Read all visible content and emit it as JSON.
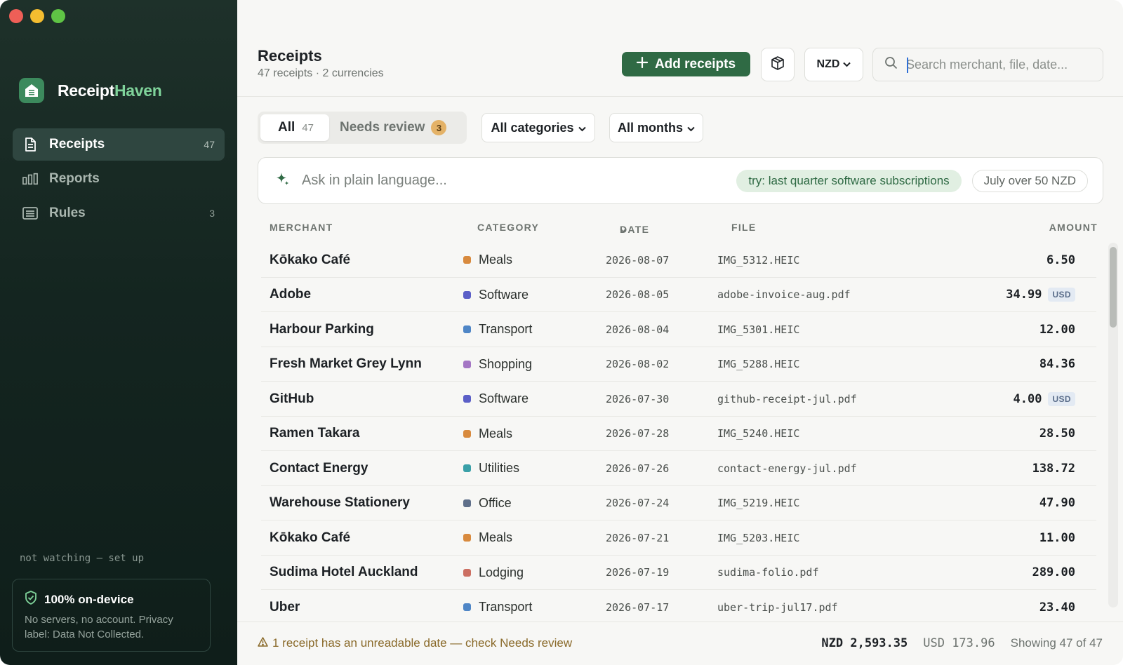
{
  "app": {
    "name_prefix": "Receipt",
    "name_accent": "Haven"
  },
  "colors": {
    "accent": "#2f6a44",
    "sidebar_bg": "#142520",
    "warning": "#8a6a2a"
  },
  "sidebar": {
    "items": [
      {
        "label": "Receipts",
        "count": "47",
        "icon": "receipt-icon",
        "active": true
      },
      {
        "label": "Reports",
        "count": "",
        "icon": "bar-chart-icon",
        "active": false
      },
      {
        "label": "Rules",
        "count": "3",
        "icon": "list-icon",
        "active": false
      }
    ],
    "watch_status": "not watching — set up",
    "privacy": {
      "title": "100% on-device",
      "text": "No servers, no account. Privacy label: Data Not Collected."
    }
  },
  "header": {
    "title": "Receipts",
    "receipt_count": "47 receipts",
    "separator": "·",
    "currency_count": "2 currencies",
    "add_label": "Add receipts",
    "currency": "NZD",
    "search_placeholder": "Search merchant, file, date..."
  },
  "filters": {
    "tabs": [
      {
        "label": "All",
        "count": "47"
      },
      {
        "label": "Needs review",
        "count": "3"
      }
    ],
    "category": "All categories",
    "month": "All months"
  },
  "ask": {
    "placeholder": "Ask in plain language...",
    "suggestion_1": "try: last quarter software subscriptions",
    "suggestion_2": "July over 50 NZD"
  },
  "table": {
    "columns": {
      "merchant": "MERCHANT",
      "category": "CATEGORY",
      "date": "DATE",
      "file": "FILE",
      "amount": "AMOUNT"
    },
    "rows": [
      {
        "merchant": "Kōkako Café",
        "category": "Meals",
        "color": "#d88a3e",
        "date": "2026-08-07",
        "file": "IMG_5312.HEIC",
        "amount": "6.50",
        "currency": ""
      },
      {
        "merchant": "Adobe",
        "category": "Software",
        "color": "#5b5fc7",
        "date": "2026-08-05",
        "file": "adobe-invoice-aug.pdf",
        "amount": "34.99",
        "currency": "USD"
      },
      {
        "merchant": "Harbour Parking",
        "category": "Transport",
        "color": "#4f86c6",
        "date": "2026-08-04",
        "file": "IMG_5301.HEIC",
        "amount": "12.00",
        "currency": ""
      },
      {
        "merchant": "Fresh Market Grey Lynn",
        "category": "Shopping",
        "color": "#a476c4",
        "date": "2026-08-02",
        "file": "IMG_5288.HEIC",
        "amount": "84.36",
        "currency": ""
      },
      {
        "merchant": "GitHub",
        "category": "Software",
        "color": "#5b5fc7",
        "date": "2026-07-30",
        "file": "github-receipt-jul.pdf",
        "amount": "4.00",
        "currency": "USD"
      },
      {
        "merchant": "Ramen Takara",
        "category": "Meals",
        "color": "#d88a3e",
        "date": "2026-07-28",
        "file": "IMG_5240.HEIC",
        "amount": "28.50",
        "currency": ""
      },
      {
        "merchant": "Contact Energy",
        "category": "Utilities",
        "color": "#3aa0a8",
        "date": "2026-07-26",
        "file": "contact-energy-jul.pdf",
        "amount": "138.72",
        "currency": ""
      },
      {
        "merchant": "Warehouse Stationery",
        "category": "Office",
        "color": "#5f6f8a",
        "date": "2026-07-24",
        "file": "IMG_5219.HEIC",
        "amount": "47.90",
        "currency": ""
      },
      {
        "merchant": "Kōkako Café",
        "category": "Meals",
        "color": "#d88a3e",
        "date": "2026-07-21",
        "file": "IMG_5203.HEIC",
        "amount": "11.00",
        "currency": ""
      },
      {
        "merchant": "Sudima Hotel Auckland",
        "category": "Lodging",
        "color": "#cc6f62",
        "date": "2026-07-19",
        "file": "sudima-folio.pdf",
        "amount": "289.00",
        "currency": ""
      },
      {
        "merchant": "Uber",
        "category": "Transport",
        "color": "#4f86c6",
        "date": "2026-07-17",
        "file": "uber-trip-jul17.pdf",
        "amount": "23.40",
        "currency": ""
      }
    ]
  },
  "footer": {
    "warning": "1 receipt has an unreadable date — check Needs review",
    "total_nzd": "NZD 2,593.35",
    "total_usd": "USD 173.96",
    "showing": "Showing 47 of 47"
  }
}
